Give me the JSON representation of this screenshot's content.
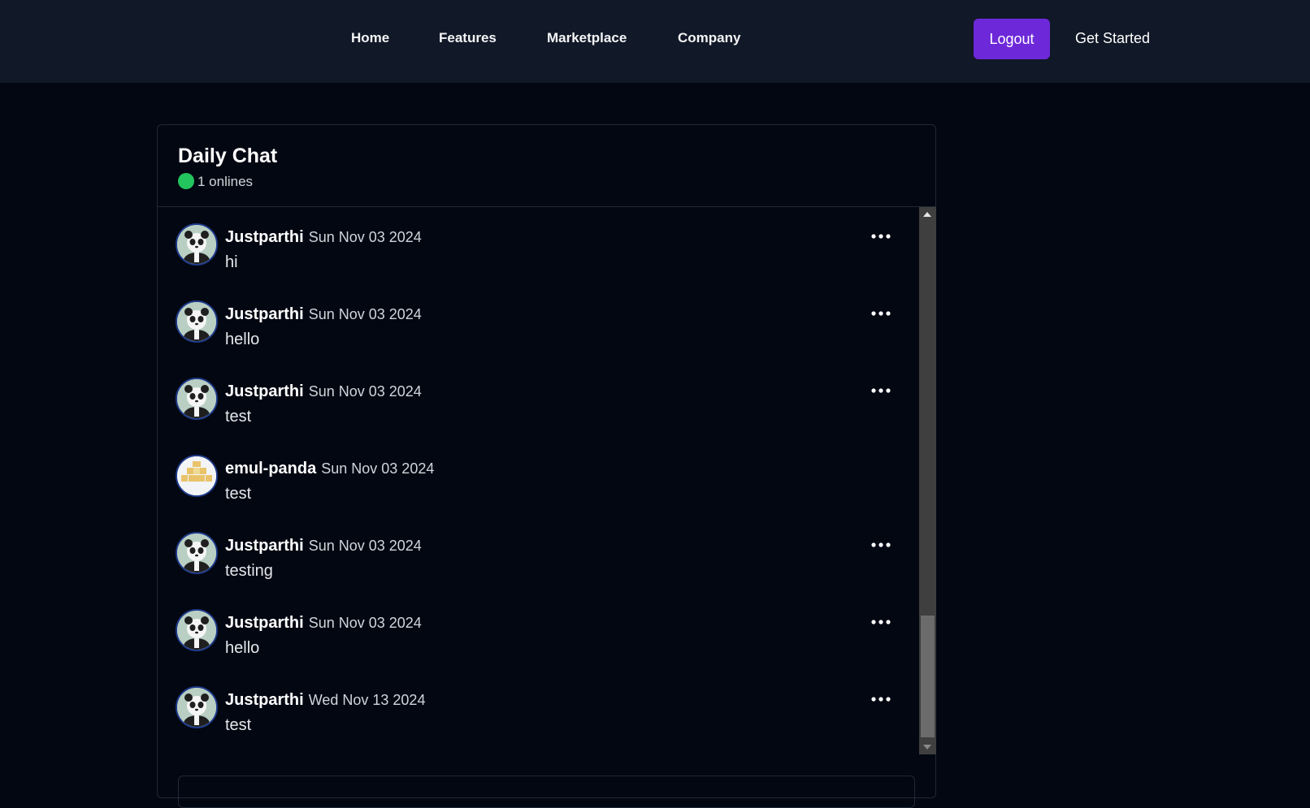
{
  "nav": {
    "links": [
      "Home",
      "Features",
      "Marketplace",
      "Company"
    ],
    "logout_label": "Logout",
    "get_started_label": "Get Started"
  },
  "chat": {
    "title": "Daily Chat",
    "online_count": "1 onlines",
    "messages": [
      {
        "user": "Justparthi",
        "date": "Sun Nov 03 2024",
        "text": "hi",
        "avatar": "panda-avatar",
        "has_menu": true
      },
      {
        "user": "Justparthi",
        "date": "Sun Nov 03 2024",
        "text": "hello",
        "avatar": "panda-avatar",
        "has_menu": true
      },
      {
        "user": "Justparthi",
        "date": "Sun Nov 03 2024",
        "text": "test",
        "avatar": "panda-avatar",
        "has_menu": true
      },
      {
        "user": "emul-panda",
        "date": "Sun Nov 03 2024",
        "text": "test",
        "avatar": "identicon-avatar",
        "has_menu": false
      },
      {
        "user": "Justparthi",
        "date": "Sun Nov 03 2024",
        "text": "testing",
        "avatar": "panda-avatar",
        "has_menu": true
      },
      {
        "user": "Justparthi",
        "date": "Sun Nov 03 2024",
        "text": "hello",
        "avatar": "panda-avatar",
        "has_menu": true
      },
      {
        "user": "Justparthi",
        "date": "Wed Nov 13 2024",
        "text": "test",
        "avatar": "panda-avatar",
        "has_menu": true
      }
    ]
  },
  "colors": {
    "background": "#030712",
    "navbar": "#111827",
    "accent": "#6d28d9",
    "online": "#22c55e"
  }
}
